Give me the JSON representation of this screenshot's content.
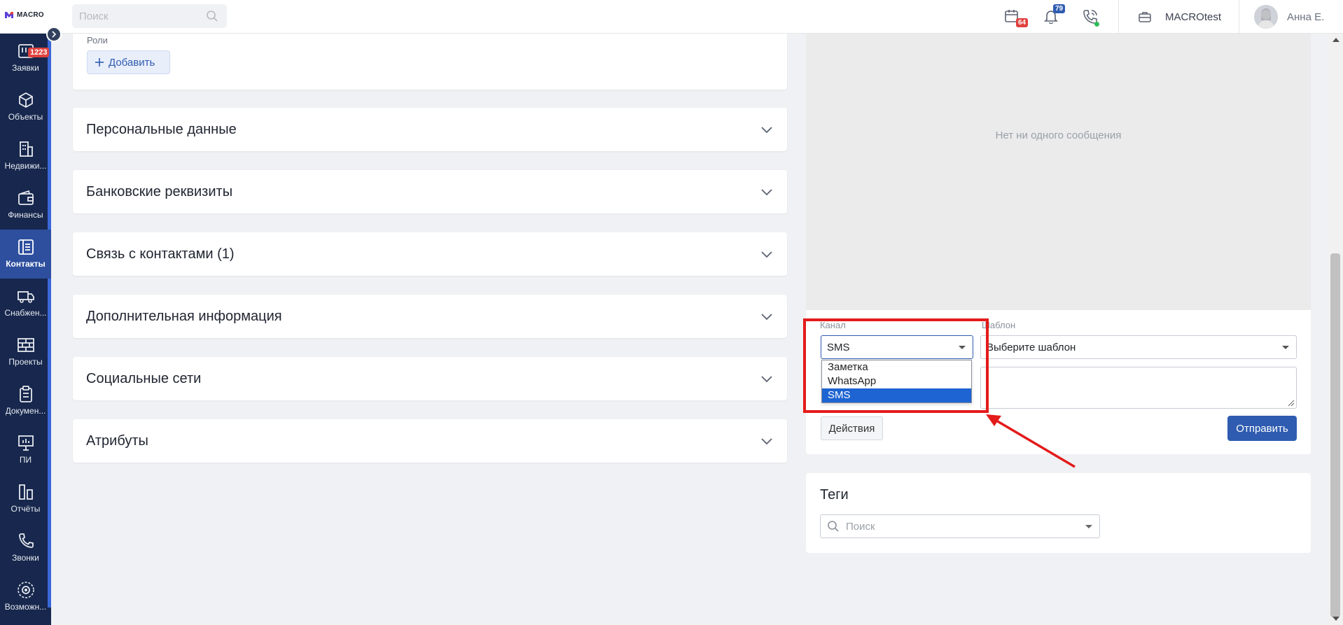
{
  "header": {
    "logo_text": "MACRO",
    "search_placeholder": "Поиск",
    "calendar_badge": "64",
    "notifications_badge": "79",
    "company": "MACROtest",
    "user_name": "Анна Е."
  },
  "sidebar": {
    "items": [
      {
        "label": "Заявки",
        "icon": "requests-icon",
        "badge": "1223"
      },
      {
        "label": "Объекты",
        "icon": "cube-icon"
      },
      {
        "label": "Недвижи...",
        "icon": "building-icon"
      },
      {
        "label": "Финансы",
        "icon": "wallet-icon"
      },
      {
        "label": "Контакты",
        "icon": "contacts-icon",
        "active": true
      },
      {
        "label": "Снабжен...",
        "icon": "truck-icon"
      },
      {
        "label": "Проекты",
        "icon": "grid-icon"
      },
      {
        "label": "Докумен...",
        "icon": "clipboard-icon"
      },
      {
        "label": "ПИ",
        "icon": "presentation-icon"
      },
      {
        "label": "Отчёты",
        "icon": "reports-icon"
      },
      {
        "label": "Звонки",
        "icon": "phone-icon"
      },
      {
        "label": "Возможн...",
        "icon": "gear-icon"
      }
    ]
  },
  "roles": {
    "label": "Роли",
    "add_label": "Добавить"
  },
  "sections": [
    "Персональные данные",
    "Банковские реквизиты",
    "Связь с контактами (1)",
    "Дополнительная информация",
    "Социальные сети",
    "Атрибуты"
  ],
  "messages": {
    "empty_text": "Нет ни одного сообщения",
    "channel_label": "Канал",
    "channel_value": "SMS",
    "channel_options": [
      "Заметка",
      "WhatsApp",
      "SMS"
    ],
    "template_label": "Шаблон",
    "template_placeholder": "Выберите шаблон",
    "actions_label": "Действия",
    "send_label": "Отправить"
  },
  "tags": {
    "title": "Теги",
    "search_placeholder": "Поиск"
  },
  "colors": {
    "sidebar_bg": "#17274d",
    "sidebar_active": "#2e4f9e",
    "primary": "#2f5cb0",
    "badge_red": "#e0413d",
    "annotation_red": "#e41b1b"
  }
}
